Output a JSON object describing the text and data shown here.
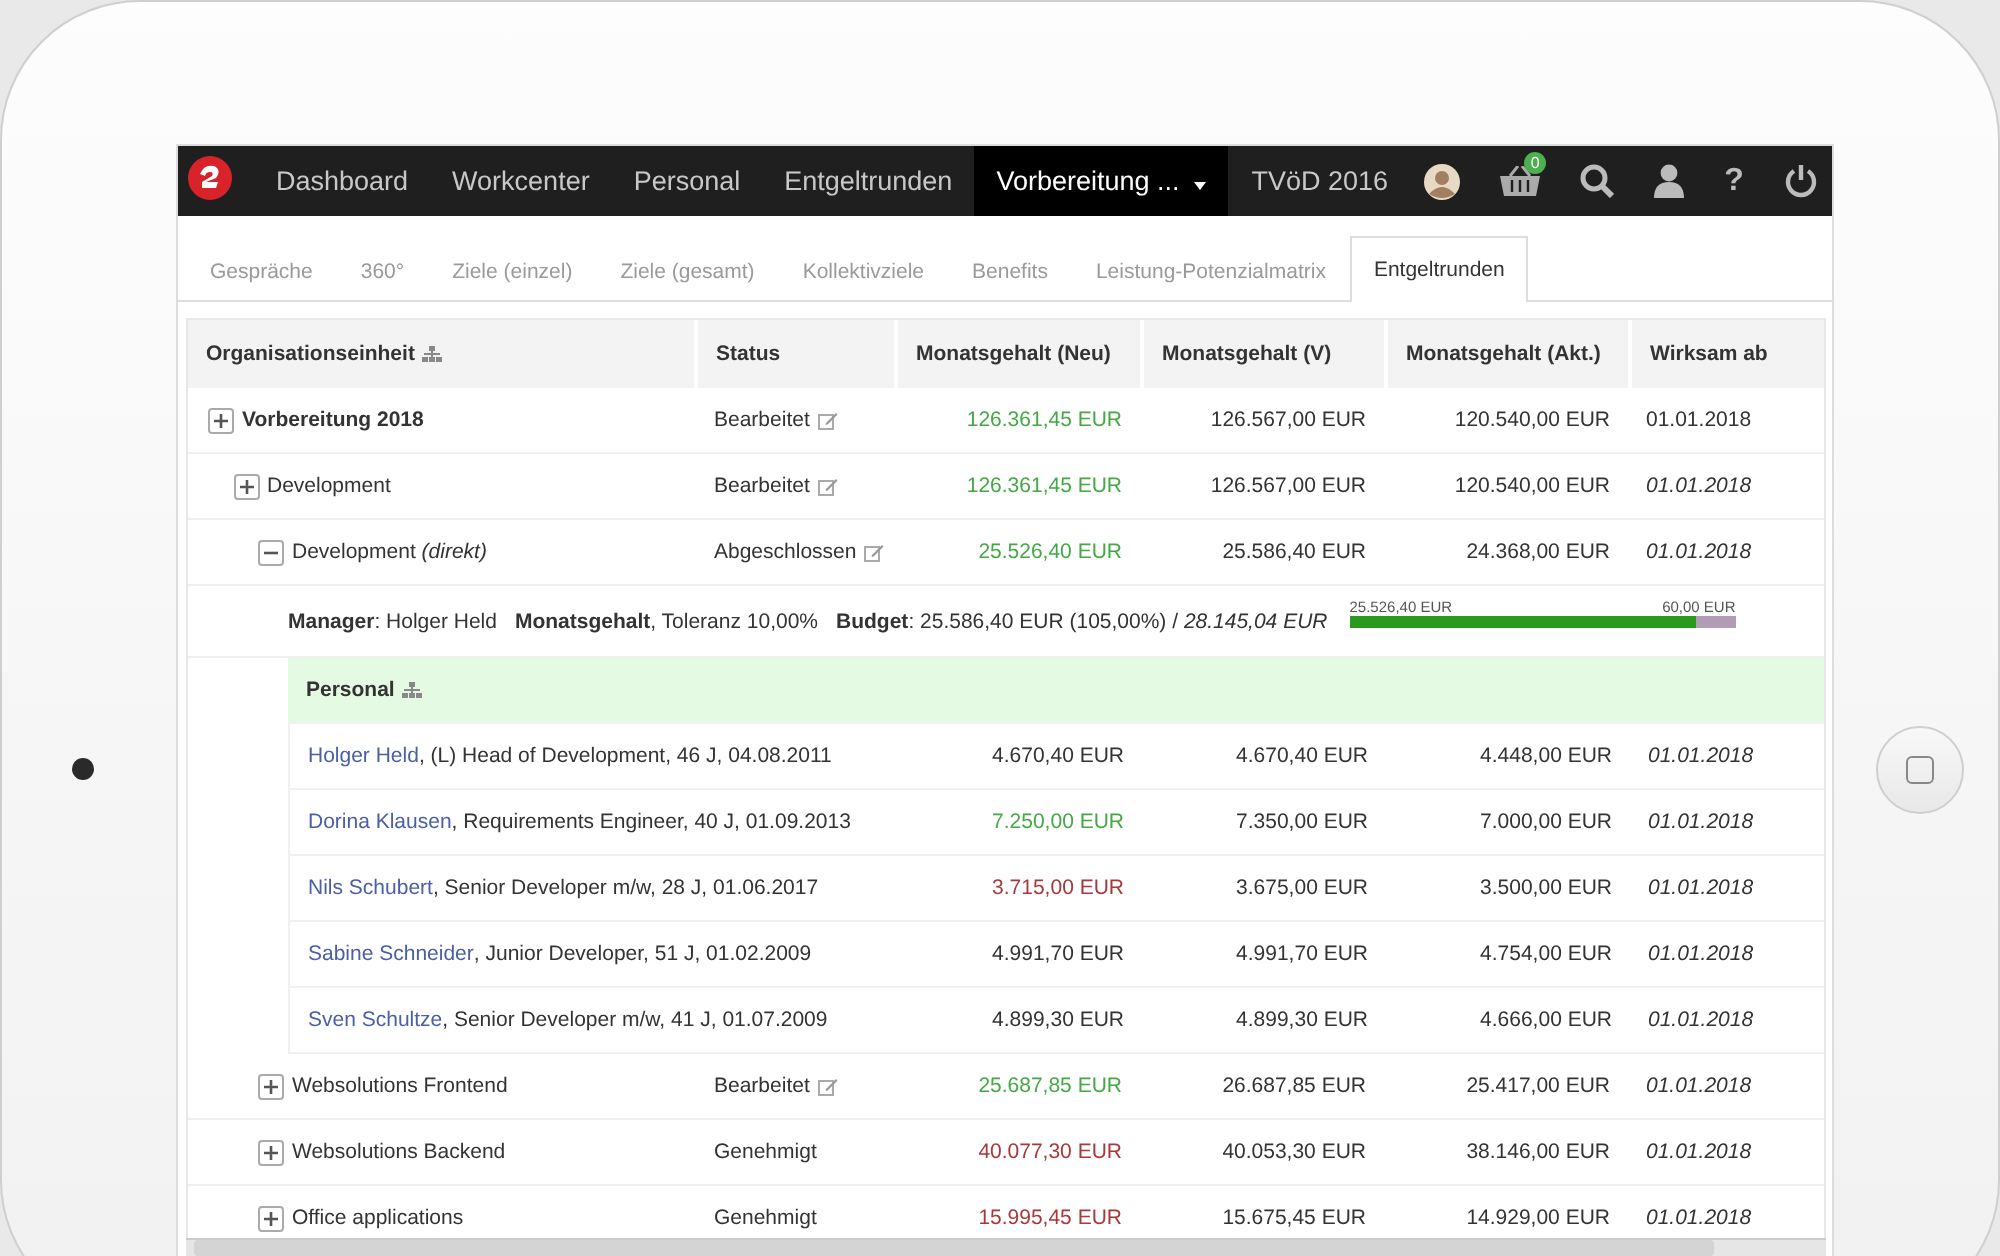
{
  "navbar": {
    "items": [
      {
        "label": "Dashboard",
        "selected": false,
        "dropdown": false
      },
      {
        "label": "Workcenter",
        "selected": false,
        "dropdown": false
      },
      {
        "label": "Personal",
        "selected": false,
        "dropdown": false
      },
      {
        "label": "Entgeltrunden",
        "selected": false,
        "dropdown": false
      },
      {
        "label": "Vorbereitung ...",
        "selected": true,
        "dropdown": true
      }
    ],
    "context": "TVöD 2016",
    "cart_badge": "0",
    "help": "?"
  },
  "tabs": [
    {
      "label": "Gespräche",
      "selected": false
    },
    {
      "label": "360°",
      "selected": false
    },
    {
      "label": "Ziele (einzel)",
      "selected": false
    },
    {
      "label": "Ziele (gesamt)",
      "selected": false
    },
    {
      "label": "Kollektivziele",
      "selected": false
    },
    {
      "label": "Benefits",
      "selected": false
    },
    {
      "label": "Leistung-Potenzialmatrix",
      "selected": false
    },
    {
      "label": "Entgeltrunden",
      "selected": true
    }
  ],
  "table": {
    "columns": [
      {
        "label": "Organisationseinheit",
        "hierarchy_icon": true
      },
      {
        "label": "Status"
      },
      {
        "label": "Monatsgehalt (Neu)"
      },
      {
        "label": "Monatsgehalt (V)"
      },
      {
        "label": "Monatsgehalt (Akt.)"
      },
      {
        "label": "Wirksam ab"
      }
    ],
    "rows": [
      {
        "label": "Vorbereitung 2018",
        "expanded": false,
        "status": "Bearbeitet",
        "editable": true,
        "salary_new": "126.361,45 EUR",
        "color": "#44a844",
        "salary_v": "126.567,00 EUR",
        "salary_current": "120.540,00 EUR",
        "effective": "01.01.2018",
        "effective_inherited": false,
        "children": [
          {
            "label": "Development",
            "expanded": false,
            "status": "Bearbeitet",
            "editable": true,
            "salary_new": "126.361,45 EUR",
            "color": "#44a844",
            "salary_v": "126.567,00 EUR",
            "salary_current": "120.540,00 EUR",
            "effective": "01.01.2018",
            "effective_inherited": true,
            "children": [
              {
                "label": "Development *(direkt)*",
                "expanded": true,
                "status": "Abgeschlossen",
                "editable": true,
                "salary_new": "25.526,40 EUR",
                "color": "#44a844",
                "salary_v": "25.586,40 EUR",
                "salary_current": "24.368,00 EUR",
                "effective": "01.01.2018",
                "effective_inherited": true,
                "details": {
                  "manager": "**Manager**: Holger Held",
                  "salary_basis": "**Monatsgehalt**, Toleranz 10,00%",
                  "budget": "**Budget**: 25.586,40 EUR (105,00%) / *28.145,04 EUR*",
                  "bar": {
                    "used_label": "25.526,40 EUR",
                    "rest_label": "60,00 EUR",
                    "level": 0.9
                  }
                },
                "staff": {
                  "title": "Personal",
                  "people": [
                    {
                      "name": "Holger Held",
                      "info": ", (L) Head of Development, 46 J, 04.08.2011",
                      "salary_new": "4.670,40 EUR",
                      "color": "#333333",
                      "salary_v": "4.670,40 EUR",
                      "salary_current": "4.448,00 EUR",
                      "effective": "01.01.2018",
                      "effective_inherited": true
                    },
                    {
                      "name": "Dorina Klausen",
                      "info": ", Requirements Engineer, 40 J, 01.09.2013",
                      "salary_new": "7.250,00 EUR",
                      "color": "#44a844",
                      "salary_v": "7.350,00 EUR",
                      "salary_current": "7.000,00 EUR",
                      "effective": "01.01.2018",
                      "effective_inherited": true
                    },
                    {
                      "name": "Nils Schubert",
                      "info": ", Senior Developer m/w, 28 J, 01.06.2017",
                      "salary_new": "3.715,00 EUR",
                      "color": "#a8383a",
                      "salary_v": "3.675,00 EUR",
                      "salary_current": "3.500,00 EUR",
                      "effective": "01.01.2018",
                      "effective_inherited": true
                    },
                    {
                      "name": "Sabine Schneider",
                      "info": ", Junior Developer, 51 J, 01.02.2009",
                      "salary_new": "4.991,70 EUR",
                      "color": "#333333",
                      "salary_v": "4.991,70 EUR",
                      "salary_current": "4.754,00 EUR",
                      "effective": "01.01.2018",
                      "effective_inherited": true
                    },
                    {
                      "name": "Sven Schultze",
                      "info": ", Senior Developer m/w, 41 J, 01.07.2009",
                      "salary_new": "4.899,30 EUR",
                      "color": "#333333",
                      "salary_v": "4.899,30 EUR",
                      "salary_current": "4.666,00 EUR",
                      "effective": "01.01.2018",
                      "effective_inherited": true
                    }
                  ]
                }
              },
              {
                "label": "Websolutions Frontend",
                "expanded": false,
                "status": "Bearbeitet",
                "editable": true,
                "salary_new": "25.687,85 EUR",
                "color": "#44a844",
                "salary_v": "26.687,85 EUR",
                "salary_current": "25.417,00 EUR",
                "effective": "01.01.2018",
                "effective_inherited": true
              },
              {
                "label": "Websolutions Backend",
                "expanded": false,
                "status": "Genehmigt",
                "editable": false,
                "salary_new": "40.077,30 EUR",
                "color": "#a8383a",
                "salary_v": "40.053,30 EUR",
                "salary_current": "38.146,00 EUR",
                "effective": "01.01.2018",
                "effective_inherited": true
              },
              {
                "label": "Office applications",
                "expanded": false,
                "status": "Genehmigt",
                "editable": false,
                "salary_new": "15.995,45 EUR",
                "color": "#a8383a",
                "salary_v": "15.675,45 EUR",
                "salary_current": "14.929,00 EUR",
                "effective": "01.01.2018",
                "effective_inherited": true
              }
            ]
          }
        ]
      }
    ]
  }
}
